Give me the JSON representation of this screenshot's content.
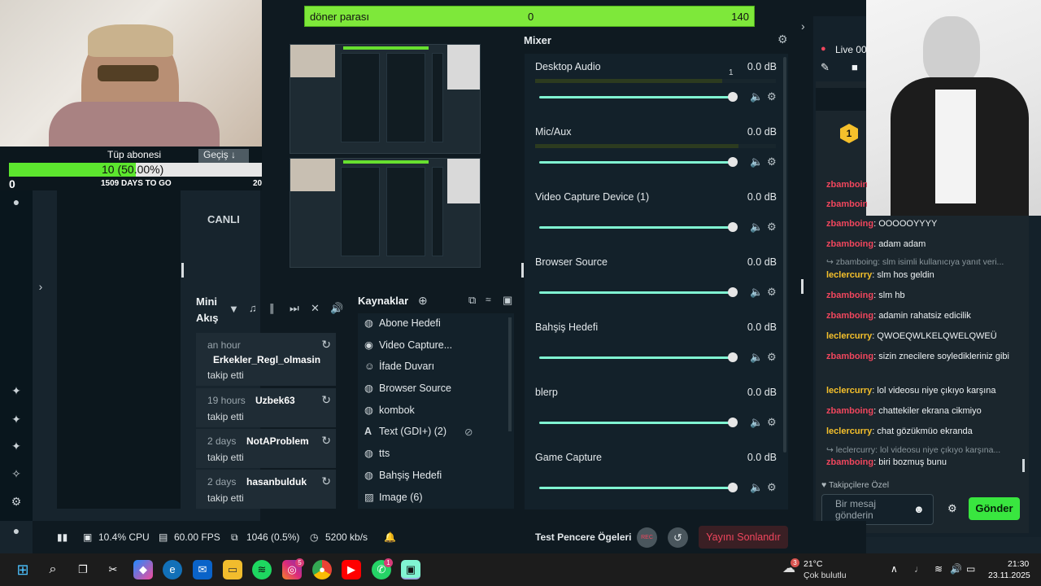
{
  "overlay": {
    "goal_bar": {
      "label": "döner parası",
      "current": "0",
      "target": "140",
      "progress": 0.0
    },
    "sub_goal": {
      "title": "Tüp abonesi",
      "value": "10 (50.00%)",
      "progress": 0.5,
      "days_left": "1509 DAYS TO GO",
      "start": "0",
      "end": "20"
    },
    "transition_button": "Geçiş ↓",
    "live_label": "CANLI"
  },
  "mixer": {
    "title": "Mixer",
    "channels": [
      {
        "name": "Desktop Audio",
        "db": "0.0 dB",
        "level": "1"
      },
      {
        "name": "Mic/Aux",
        "db": "0.0 dB"
      },
      {
        "name": "Video Capture Device (1)",
        "db": "0.0 dB"
      },
      {
        "name": "Browser Source",
        "db": "0.0 dB"
      },
      {
        "name": "Bahşiş Hedefi",
        "db": "0.0 dB"
      },
      {
        "name": "blerp",
        "db": "0.0 dB"
      },
      {
        "name": "Game Capture",
        "db": "0.0 dB"
      }
    ]
  },
  "mini_feed": {
    "title_line1": "Mini",
    "title_line2": "Akış",
    "items": [
      {
        "time": "an hour",
        "name": "Erkekler_Regl_olmasin",
        "action": "takip etti"
      },
      {
        "time": "19 hours",
        "name": "Uzbek63",
        "action": "takip etti"
      },
      {
        "time": "2 days",
        "name": "NotAProblem",
        "action": "takip etti"
      },
      {
        "time": "2 days",
        "name": "hasanbulduk",
        "action": "takip etti"
      }
    ]
  },
  "sources": {
    "title": "Kaynaklar",
    "items": [
      {
        "label": "Abone Hedefi",
        "icon": "globe-icon"
      },
      {
        "label": "Video Capture...",
        "icon": "camera-icon"
      },
      {
        "label": "İfade Duvarı",
        "icon": "emoji-icon"
      },
      {
        "label": "Browser Source",
        "icon": "globe-icon"
      },
      {
        "label": "kombok",
        "icon": "globe-icon"
      },
      {
        "label": "Text (GDI+) (2)",
        "icon": "text-icon"
      },
      {
        "label": "tts",
        "icon": "globe-icon"
      },
      {
        "label": "Bahşiş Hedefi",
        "icon": "globe-icon"
      },
      {
        "label": "Image (6)",
        "icon": "image-icon"
      }
    ]
  },
  "chat": {
    "live_label": "Live 00",
    "badge_number": "1",
    "messages": [
      {
        "user": "zbamboing",
        "text": "OOOOOYYYY",
        "color": "#f0465d"
      },
      {
        "user": "zbamboing",
        "text": "adam adam",
        "color": "#f0465d"
      },
      {
        "reply": "zbamboing: slm isimli kullanıcıya yanıt veri..."
      },
      {
        "user": "leclercurry",
        "text": "slm hos geldin",
        "color": "#f5c02b"
      },
      {
        "user": "zbamboing",
        "text": "slm hb",
        "color": "#f0465d"
      },
      {
        "user": "zbamboing",
        "text": "adamin rahatsiz edicilik",
        "color": "#f0465d"
      },
      {
        "user": "leclercurry",
        "text": "QWOEQWLKELQWELQWEÜ",
        "color": "#f5c02b"
      },
      {
        "user": "zbamboing",
        "text": "sizin znecilere soyledikleriniz gibi",
        "color": "#f0465d"
      },
      {
        "user": "leclercurry",
        "text": "lol videosu niye çıkıyo karşına",
        "color": "#f5c02b"
      },
      {
        "user": "zbamboing",
        "text": "chattekiler ekrana cikmiyo",
        "color": "#f0465d"
      },
      {
        "user": "leclercurry",
        "text": "chat gözükmüo ekranda",
        "color": "#f5c02b"
      },
      {
        "reply": "leclercurry: lol videosu niye çıkıyo karşına..."
      },
      {
        "user": "zbamboing",
        "text": "biri bozmuş bunu",
        "color": "#f0465d"
      }
    ],
    "followers_only": "Takipçilere Özel",
    "input_placeholder": "Bir mesaj gönderin",
    "send_label": "Gönder"
  },
  "footer": {
    "cpu": "10.4% CPU",
    "fps": "60.00 FPS",
    "dropped": "1046 (0.5%)",
    "bitrate": "5200 kb/s",
    "test_widgets": "Test Pencere Ögeleri",
    "rec": "REC",
    "end_stream": "Yayını Sonlandır"
  },
  "taskbar": {
    "weather_temp": "21°C",
    "weather_desc": "Çok bulutlu",
    "time": "21:30",
    "date": "23.11.2025",
    "notif_badge": "3",
    "instagram_badge": "5",
    "whatsapp_badge": "1"
  },
  "colors": {
    "accent_green": "#5ce62e",
    "teal": "#80f5d2",
    "red": "#f0465d",
    "yellow": "#f5c02b"
  }
}
